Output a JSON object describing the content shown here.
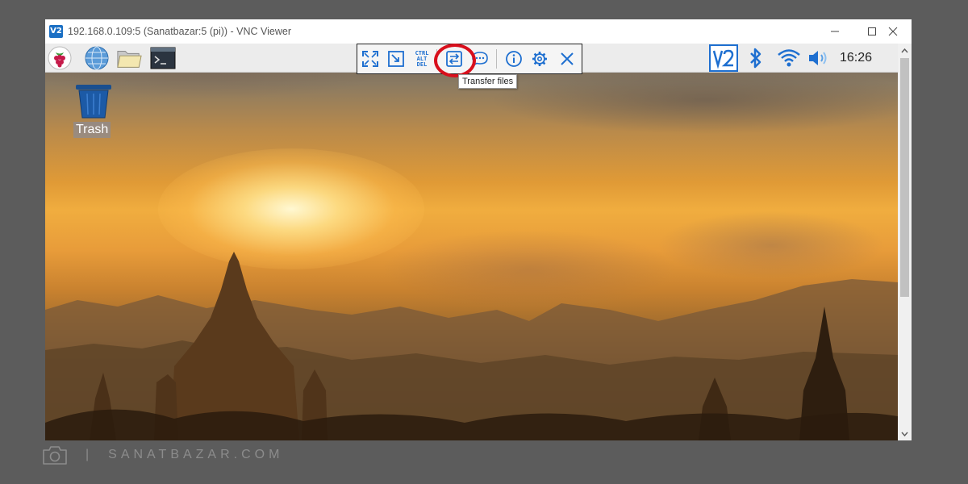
{
  "window": {
    "title": "192.168.0.109:5 (Sanatbazar:5 (pi)) - VNC Viewer",
    "logo_text": "V2"
  },
  "panel": {
    "clock": "16:26",
    "launchers": [
      "raspberry-menu",
      "web-browser",
      "file-manager",
      "terminal"
    ]
  },
  "vnc_toolbar": {
    "buttons": [
      "full-screen",
      "scale-to-window",
      "ctrl-alt-del",
      "transfer-files",
      "chat",
      "info",
      "settings",
      "close-session"
    ],
    "ctrl_alt_del_lines": [
      "CTRL",
      "ALT",
      "DEL"
    ],
    "tooltip": "Transfer files",
    "highlighted": "transfer-files"
  },
  "desktop": {
    "icons": [
      {
        "label": "Trash"
      }
    ]
  },
  "watermark": {
    "separator": "|",
    "text": "SANATBAZAR.COM"
  },
  "colors": {
    "accent": "#1e6fd0",
    "highlight": "#d80f1c",
    "panel_bg": "#ececec",
    "backdrop": "#5c5c5c"
  }
}
